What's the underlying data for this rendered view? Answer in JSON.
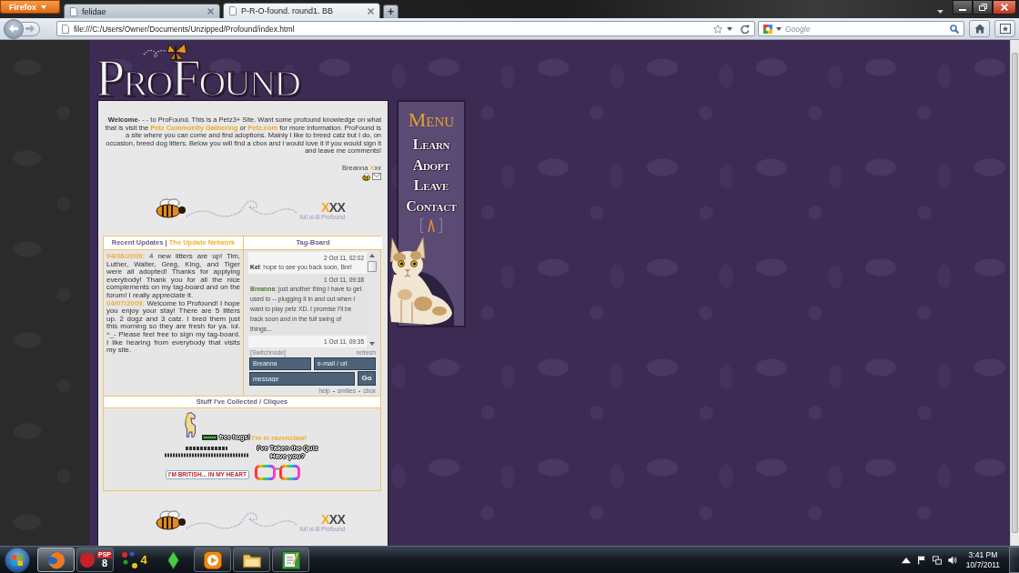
{
  "browser": {
    "menu_button": "Firefox",
    "tabs": [
      {
        "title": "felidae",
        "selected": false
      },
      {
        "title": "P-R-O-found. round1. BB",
        "selected": true
      }
    ],
    "new_tab": "+",
    "address": "file:///C:/Users/Owner/Documents/Unzipped/Profound/index.html",
    "search": {
      "placeholder": "Google"
    }
  },
  "site": {
    "logo": "ProFound",
    "welcome": [
      {
        "kind": "text",
        "text": "**Welcome**- - - to ProFound. This is a Petz3+ Site. Want some profound knowledge on what that is visit the "
      },
      {
        "kind": "link",
        "text": "Petz Community Gathering"
      },
      {
        "kind": "text",
        "text": " or "
      },
      {
        "kind": "link",
        "text": "Petz.com"
      },
      {
        "kind": "text",
        "text": " for more information. ProFound is a site where you can come and find adoptions. Mainly I like to breed catz but I do, on occasion, breed dog litters. Below you will find a cbox and I would love it if you would sign it and leave me comments!"
      }
    ],
    "signature": [
      {
        "text": "Breanna ",
        "accent": false
      },
      {
        "text": "X",
        "accent": true
      },
      {
        "text": "xx",
        "accent": false
      }
    ],
    "banner": {
      "mark": [
        {
          "text": "X",
          "accent": true
        },
        {
          "text": "XX",
          "accent": false
        }
      ],
      "caption": "full ol-B Profound"
    },
    "updates": {
      "title": "Recent Updates",
      "separator": "|",
      "link": "The Update Network",
      "entries": [
        {
          "date": "04/08/2009:",
          "text": "4 new litters are up! Tim, Luther, Walter, Greg, King, and Tiger were all adopted! Thanks for applying everybody! Thank you for all the nice complements on my tag-board and on the forum! I really appreciate it."
        },
        {
          "date": "04/07/2009:",
          "text": "Welcome to Profound! I hope you enjoy your stay! There are 5 litters up. 2 dogz and 3 catz. I bred them just this morning so they are fresh for ya. lol. ^_- Please feel free to sign my tag-board. I like hearing from everybody that visits my site."
        }
      ]
    },
    "tagboard": {
      "title": "Tag-Board",
      "messages": [
        {
          "time": "2 Oct 11, 02:02",
          "author": "Kel",
          "text": ": hope to see you back soon, Bre!",
          "owner": false
        },
        {
          "time": "1 Oct 11, 09:38",
          "author": "Breanna",
          "text": ": just another thing I have to get used to -- plugging it in and out when I want to play petz XD. I promise I'll be back soon and in the full swing of things...",
          "owner": true
        },
        {
          "time": "1 Oct 11, 09:35"
        }
      ],
      "switch_link": "[Switchnode]",
      "refresh_link": "refresh",
      "name_value": "Breanna",
      "email_placeholder": "e-mail / url",
      "message_placeholder": "message",
      "submit": "Go",
      "links": [
        {
          "kind": "link",
          "text": "help"
        },
        {
          "kind": "sep",
          "text": "-"
        },
        {
          "kind": "link",
          "text": "smilies"
        },
        {
          "kind": "sep",
          "text": "-"
        },
        {
          "kind": "link",
          "text": "cbox"
        }
      ]
    },
    "cliques": {
      "title": "Stuff I've Collected / Cliques",
      "hugs": "free hugs!",
      "ravenclaw": "I'm in ravenclaw!",
      "quiz": [
        "I've Taken the Quiz",
        "Have you?"
      ],
      "british": "I'M BRITISH... IN MY HEART"
    },
    "footer_banner": {
      "mark": [
        {
          "text": "X",
          "accent": true
        },
        {
          "text": "XX",
          "accent": false
        }
      ],
      "caption": "full ol-B Profound"
    },
    "menu": {
      "title": "Menu",
      "items": [
        "Learn",
        "Adopt",
        "Leave",
        "Contact"
      ]
    }
  },
  "taskbar": {
    "apps": [
      {
        "kind": "browser",
        "running": true,
        "selected": true
      },
      {
        "kind": "paint",
        "badge": "PSP",
        "glyph": "8",
        "running": true,
        "selected": false
      },
      {
        "kind": "game",
        "glyph": "4",
        "running": false,
        "selected": false
      },
      {
        "kind": "diamond",
        "running": false,
        "selected": false
      },
      {
        "kind": "media",
        "running": true,
        "selected": false
      },
      {
        "kind": "folder",
        "running": true,
        "selected": false
      },
      {
        "kind": "notepad",
        "running": true,
        "selected": false
      }
    ],
    "clock": {
      "time": "3:41 PM",
      "date": "10/7/2011"
    }
  }
}
